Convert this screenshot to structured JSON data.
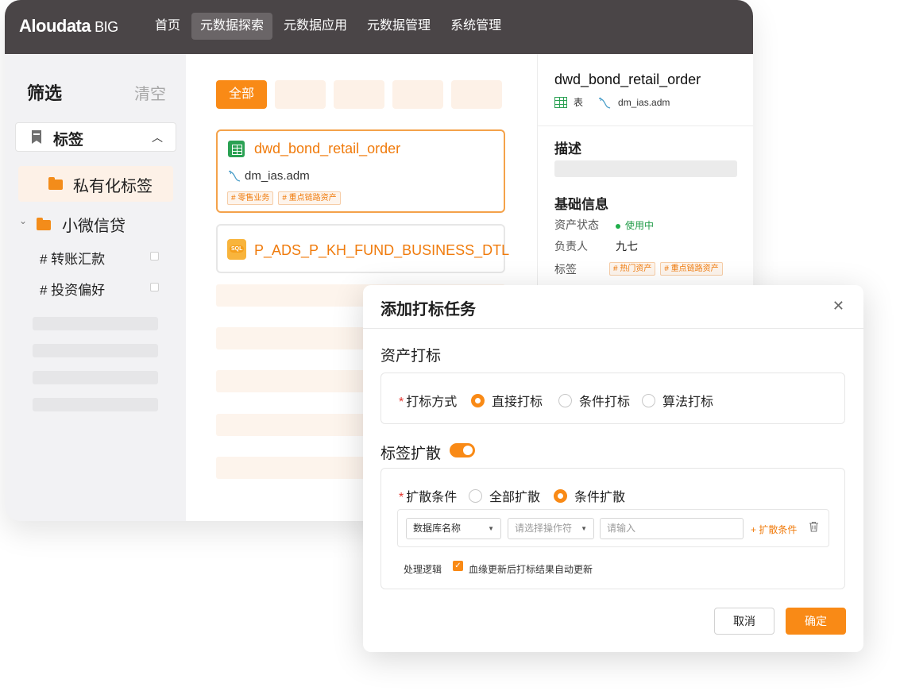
{
  "brand": {
    "name": "Aloudata",
    "suffix": "BIG"
  },
  "nav": [
    {
      "label": "首页"
    },
    {
      "label": "元数据探索",
      "active": true
    },
    {
      "label": "元数据应用"
    },
    {
      "label": "元数据管理"
    },
    {
      "label": "系统管理"
    }
  ],
  "sidebar": {
    "title": "筛选",
    "clear": "清空",
    "tag_section": "标签",
    "private_folder": "私有化标签",
    "group": "小微信贷",
    "leaves": [
      "# 转账汇款",
      "# 投资偏好"
    ]
  },
  "list": {
    "chip_all": "全部",
    "cards": [
      {
        "title": "dwd_bond_retail_order",
        "db": "dm_ias.adm",
        "tags": [
          "# 零售业务",
          "# 重点链路资产"
        ]
      },
      {
        "title": "P_ADS_P_KH_FUND_BUSINESS_DTL"
      }
    ]
  },
  "detail": {
    "title": "dwd_bond_retail_order",
    "type": "表",
    "db": "dm_ias.adm",
    "desc_heading": "描述",
    "basic_heading": "基础信息",
    "status_key": "资产状态",
    "status_value": "使用中",
    "owner_key": "负责人",
    "owner_value": "九七",
    "tags_key": "标签",
    "tags": [
      "# 热门资产",
      "# 重点链路资产"
    ]
  },
  "modal": {
    "title": "添加打标任务",
    "section1": "资产打标",
    "method_label": "打标方式",
    "methods": [
      "直接打标",
      "条件打标",
      "算法打标"
    ],
    "selected_method": "直接打标",
    "section2": "标签扩散",
    "expand_enabled": true,
    "expand_label": "扩散条件",
    "expand_options": [
      "全部扩散",
      "条件扩散"
    ],
    "selected_expand": "条件扩散",
    "field_select": "数据库名称",
    "operator_placeholder": "请选择操作符",
    "value_placeholder": "请输入",
    "add_condition": "+ 扩散条件",
    "logic_label": "处理逻辑",
    "auto_update": "血缘更新后打标结果自动更新",
    "auto_update_checked": true,
    "cancel": "取消",
    "confirm": "确定"
  },
  "colors": {
    "accent": "#f98a16",
    "topbar": "#4a4547",
    "success": "#1fae4a"
  }
}
